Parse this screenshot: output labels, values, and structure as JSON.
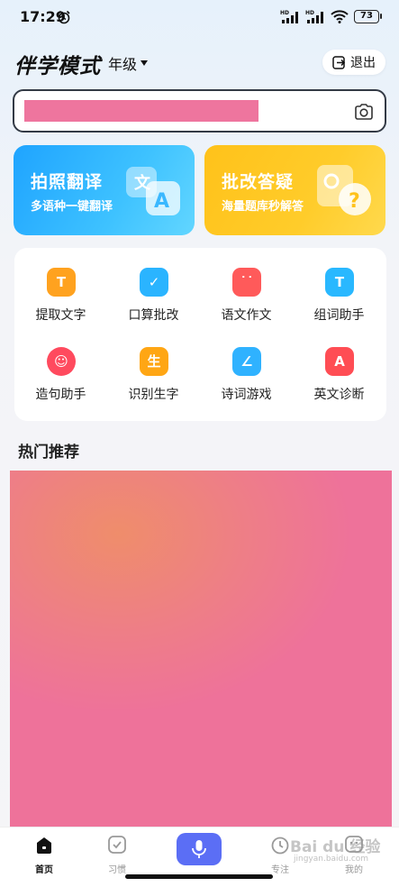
{
  "status_bar": {
    "time": "17:29",
    "battery": "73",
    "network1": "HD",
    "network2": "HD"
  },
  "header": {
    "title": "伴学模式",
    "grade_label": "年级",
    "exit_label": "退出"
  },
  "search": {
    "placeholder": ""
  },
  "cards": [
    {
      "title": "拍照翻译",
      "subtitle": "多语种一键翻译",
      "icon": "translate-icon",
      "color": "#1fa4ff"
    },
    {
      "title": "批改答疑",
      "subtitle": "海量题库秒解答",
      "icon": "question-icon",
      "color": "#ffc21a"
    }
  ],
  "tools": [
    {
      "label": "提取文字",
      "glyph": "T",
      "color": "#ffa21f",
      "icon": "extract-text-icon"
    },
    {
      "label": "口算批改",
      "glyph": "✓",
      "color": "#2ab4ff",
      "icon": "arithmetic-check-icon"
    },
    {
      "label": "语文作文",
      "glyph": "˙˙",
      "color": "#ff5a5a",
      "icon": "essay-icon"
    },
    {
      "label": "组词助手",
      "glyph": "T",
      "color": "#29b8ff",
      "icon": "word-helper-icon"
    },
    {
      "label": "造句助手",
      "glyph": "☺",
      "color": "#ff4a5e",
      "icon": "sentence-helper-icon"
    },
    {
      "label": "识别生字",
      "glyph": "生",
      "color": "#ffa614",
      "icon": "recognize-char-icon"
    },
    {
      "label": "诗词游戏",
      "glyph": "∠",
      "color": "#2fb2ff",
      "icon": "poetry-game-icon"
    },
    {
      "label": "英文诊断",
      "glyph": "A",
      "color": "#ff4d54",
      "icon": "english-diagnosis-icon"
    }
  ],
  "section": {
    "hot_title": "热门推荐"
  },
  "nav": {
    "home": "首页",
    "habit": "习惯",
    "focus": "专注",
    "mine": "我的"
  },
  "watermark": {
    "brand": "Bai du 经验",
    "url": "jingyan.baidu.com"
  },
  "colors": {
    "accent": "#5b6ef5",
    "banner": "#ee729a",
    "redaction": "#ee759e"
  }
}
